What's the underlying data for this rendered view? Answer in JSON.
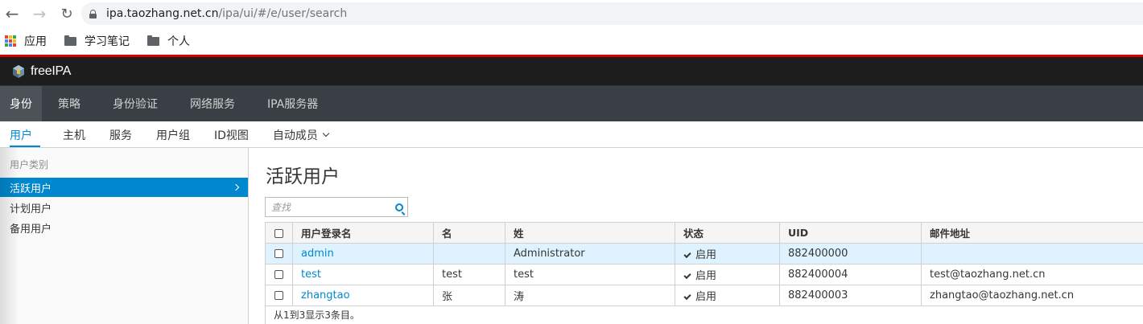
{
  "browser": {
    "url_host": "ipa.taozhang.net.cn",
    "url_path": "/ipa/ui/#/e/user/search",
    "bookmarks": [
      {
        "label": "应用",
        "icon": "apps-icon"
      },
      {
        "label": "学习笔记",
        "icon": "folder-icon"
      },
      {
        "label": "个人",
        "icon": "folder-icon"
      }
    ]
  },
  "header": {
    "brand": "freeIPA"
  },
  "main_nav": [
    {
      "label": "身份",
      "active": true
    },
    {
      "label": "策略",
      "active": false
    },
    {
      "label": "身份验证",
      "active": false
    },
    {
      "label": "网络服务",
      "active": false
    },
    {
      "label": "IPA服务器",
      "active": false
    }
  ],
  "sub_nav": [
    {
      "label": "用户",
      "active": true
    },
    {
      "label": "主机",
      "active": false
    },
    {
      "label": "服务",
      "active": false
    },
    {
      "label": "用户组",
      "active": false
    },
    {
      "label": "ID视图",
      "active": false
    },
    {
      "label": "自动成员",
      "active": false,
      "dropdown": true
    }
  ],
  "sidebar": {
    "heading": "用户类别",
    "items": [
      {
        "label": "活跃用户",
        "active": true
      },
      {
        "label": "计划用户",
        "active": false
      },
      {
        "label": "备用用户",
        "active": false
      }
    ]
  },
  "content": {
    "title": "活跃用户",
    "search_placeholder": "查找",
    "columns": [
      "用户登录名",
      "名",
      "姓",
      "状态",
      "UID",
      "邮件地址"
    ],
    "rows": [
      {
        "login": "admin",
        "first": "",
        "last": "Administrator",
        "status": "启用",
        "uid": "882400000",
        "email": "",
        "highlight": true
      },
      {
        "login": "test",
        "first": "test",
        "last": "test",
        "status": "启用",
        "uid": "882400004",
        "email": "test@taozhang.net.cn",
        "highlight": false
      },
      {
        "login": "zhangtao",
        "first": "张",
        "last": "涛",
        "status": "启用",
        "uid": "882400003",
        "email": "zhangtao@taozhang.net.cn",
        "highlight": false
      }
    ],
    "footer": "从1到3显示3条目。"
  },
  "colors": {
    "accent": "#0088ce",
    "header_bg": "#1d1d1d",
    "nav_bg": "#393f44",
    "red_rule": "#cc0000"
  }
}
